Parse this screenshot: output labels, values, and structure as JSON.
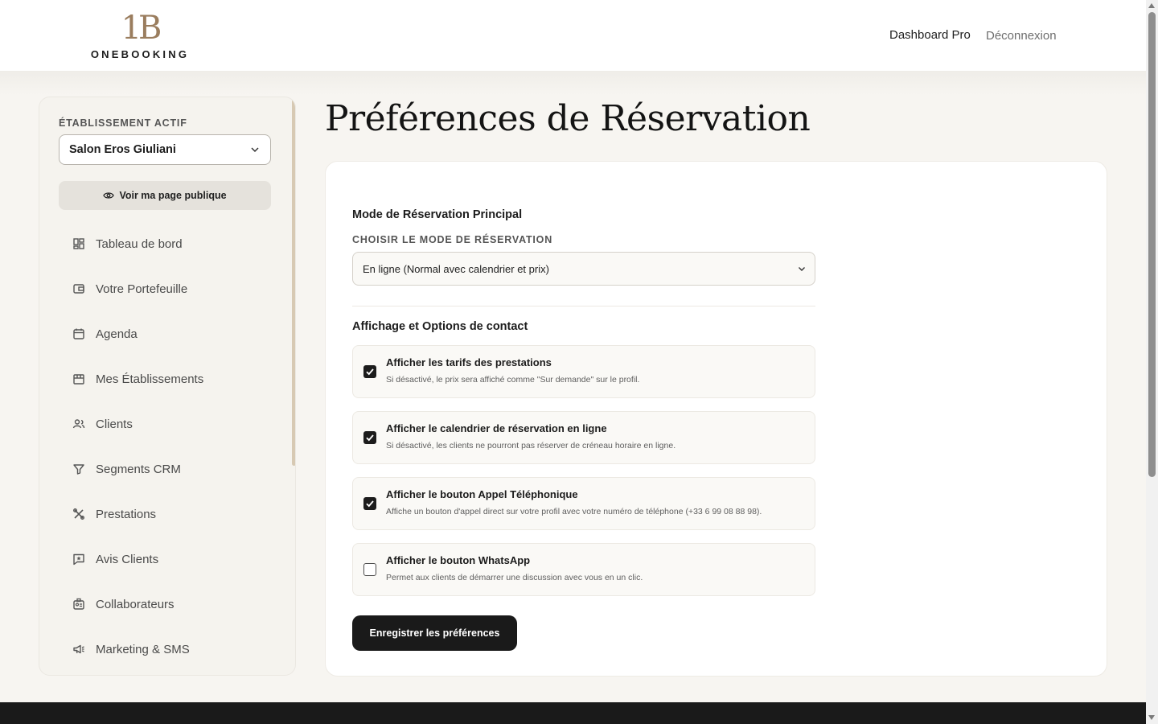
{
  "header": {
    "logo_mark": "1B",
    "logo_word": "ONEBOOKING",
    "nav_pro": "Dashboard Pro",
    "nav_logout": "Déconnexion"
  },
  "sidebar": {
    "active_label": "ÉTABLISSEMENT ACTIF",
    "establishment": "Salon Eros Giuliani",
    "public_page": "Voir ma page publique",
    "items": [
      {
        "label": "Tableau de bord",
        "icon": "dashboard-icon"
      },
      {
        "label": "Votre Portefeuille",
        "icon": "wallet-icon"
      },
      {
        "label": "Agenda",
        "icon": "calendar-icon"
      },
      {
        "label": "Mes Établissements",
        "icon": "store-icon"
      },
      {
        "label": "Clients",
        "icon": "users-icon"
      },
      {
        "label": "Segments CRM",
        "icon": "filter-icon"
      },
      {
        "label": "Prestations",
        "icon": "tools-icon"
      },
      {
        "label": "Avis Clients",
        "icon": "review-icon"
      },
      {
        "label": "Collaborateurs",
        "icon": "badge-icon"
      },
      {
        "label": "Marketing & SMS",
        "icon": "megaphone-icon"
      }
    ]
  },
  "main": {
    "title": "Préférences de Réservation",
    "section_mode": "Mode de Réservation Principal",
    "mode_label": "CHOISIR LE MODE DE RÉSERVATION",
    "mode_value": "En ligne (Normal avec calendrier et prix)",
    "section_display": "Affichage et Options de contact",
    "options": [
      {
        "title": "Afficher les tarifs des prestations",
        "desc": "Si désactivé, le prix sera affiché comme \"Sur demande\" sur le profil.",
        "checked": true
      },
      {
        "title": "Afficher le calendrier de réservation en ligne",
        "desc": "Si désactivé, les clients ne pourront pas réserver de créneau horaire en ligne.",
        "checked": true
      },
      {
        "title": "Afficher le bouton Appel Téléphonique",
        "desc": "Affiche un bouton d'appel direct sur votre profil avec votre numéro de téléphone (+33 6 99 08 88 98).",
        "checked": true
      },
      {
        "title": "Afficher le bouton WhatsApp",
        "desc": "Permet aux clients de démarrer une discussion avec vous en un clic.",
        "checked": false
      }
    ],
    "save_label": "Enregistrer les préférences"
  },
  "colors": {
    "accent_gold": "#9a7d5e",
    "dark": "#1a1a1a",
    "background": "#f7f5f1"
  }
}
